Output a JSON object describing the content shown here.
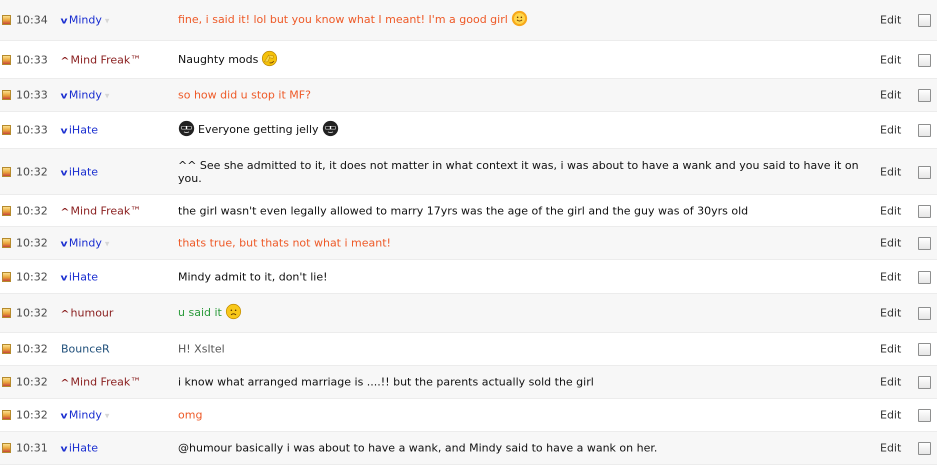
{
  "messages": [
    {
      "time": "10:34",
      "user": "Mindy",
      "text": "fine, i said it! lol but you know what I meant! I'm a good girl",
      "edit": "Edit"
    },
    {
      "time": "10:33",
      "user": "Mind Freak™",
      "text": "Naughty mods",
      "edit": "Edit"
    },
    {
      "time": "10:33",
      "user": "Mindy",
      "text": "so how did u stop it MF?",
      "edit": "Edit"
    },
    {
      "time": "10:33",
      "user": "iHate",
      "text": "Everyone getting jelly",
      "edit": "Edit"
    },
    {
      "time": "10:32",
      "user": "iHate",
      "text": "^^ See she admitted to it, it does not matter in what context it was, i was about to have a wank and you said to have it on you.",
      "edit": "Edit"
    },
    {
      "time": "10:32",
      "user": "Mind Freak™",
      "text": "the girl wasn't even legally allowed to marry 17yrs was the age of the girl and the guy was of 30yrs old",
      "edit": "Edit"
    },
    {
      "time": "10:32",
      "user": "Mindy",
      "text": "thats true, but thats not what i meant!",
      "edit": "Edit"
    },
    {
      "time": "10:32",
      "user": "iHate",
      "text": "Mindy admit to it, don't lie!",
      "edit": "Edit"
    },
    {
      "time": "10:32",
      "user": "humour",
      "text": "u said it",
      "edit": "Edit"
    },
    {
      "time": "10:32",
      "user": "BounceR",
      "text": "H! Xsltel",
      "edit": "Edit"
    },
    {
      "time": "10:32",
      "user": "Mind Freak™",
      "text": "i know what arranged marriage is ....!! but the parents actually sold the girl",
      "edit": "Edit"
    },
    {
      "time": "10:32",
      "user": "Mindy",
      "text": "omg",
      "edit": "Edit"
    },
    {
      "time": "10:31",
      "user": "iHate",
      "text": "@humour basically i was about to have a wank, and Mindy said to have a wank on her.",
      "edit": "Edit"
    }
  ],
  "rank_glyphs": {
    "up": "^",
    "down": "v"
  },
  "caret_glyph": "▾",
  "colors": {
    "user_blue": "#1a2ed0",
    "user_red": "#8a1f1f",
    "msg_orange": "#ee5a28",
    "msg_green": "#2a9a3a",
    "row_alt": "#f7f7f7"
  }
}
